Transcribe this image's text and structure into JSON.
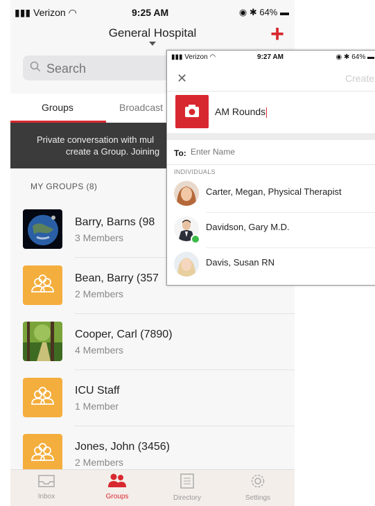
{
  "status": {
    "carrier": "Verizon",
    "time": "9:25 AM",
    "battery": "64%"
  },
  "nav": {
    "title": "General Hospital",
    "plus_icon": "plus-icon"
  },
  "search": {
    "placeholder": "Search"
  },
  "tabs": [
    {
      "label": "Groups",
      "active": true
    },
    {
      "label": "Broadcast",
      "active": false
    }
  ],
  "banner": {
    "line1": "Private conversation with mul",
    "line2": "create a Group. Joining"
  },
  "section_title": "MY GROUPS (8)",
  "groups": [
    {
      "name": "Barry, Barns (98",
      "members": "3 Members",
      "avatar": "earth-image"
    },
    {
      "name": "Bean, Barry (357",
      "members": "2 Members",
      "avatar": "group-icon"
    },
    {
      "name": "Cooper, Carl (7890)",
      "members": "4 Members",
      "avatar": "forest-image"
    },
    {
      "name": "ICU Staff",
      "members": "1 Member",
      "avatar": "group-icon"
    },
    {
      "name": "Jones, John (3456)",
      "members": "2 Members",
      "avatar": "group-icon"
    }
  ],
  "tabbar": [
    {
      "label": "Inbox",
      "icon": "inbox-icon"
    },
    {
      "label": "Groups",
      "icon": "groups-icon",
      "active": true
    },
    {
      "label": "Directory",
      "icon": "directory-icon"
    },
    {
      "label": "Settings",
      "icon": "gear-icon"
    }
  ],
  "overlay": {
    "status": {
      "carrier": "Verizon",
      "time": "9:27 AM",
      "battery": "64%"
    },
    "create_label": "Create",
    "group_name": "AM Rounds",
    "to_label": "To:",
    "to_placeholder": "Enter Name",
    "individuals_label": "INDIVIDUALS",
    "people": [
      {
        "name": "Carter, Megan, Physical Therapist"
      },
      {
        "name": "Davidson, Gary M.D.",
        "online": true
      },
      {
        "name": "Davis, Susan RN"
      }
    ]
  },
  "colors": {
    "accent": "#d8282f",
    "group_avatar": "#f4ae3d",
    "banner": "#3b3b3b"
  }
}
